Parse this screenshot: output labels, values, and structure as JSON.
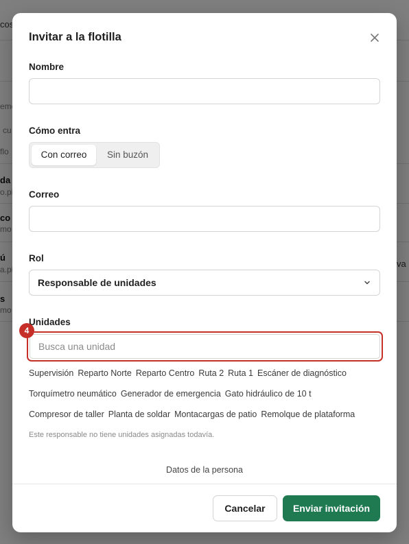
{
  "background": {
    "fragments": [
      "cos",
      "emo",
      "cu",
      "flo",
      "da",
      "o.pi",
      "co",
      "mo",
      "ú",
      "a.pi",
      "s",
      "mo",
      "va"
    ]
  },
  "modal": {
    "title": "Invitar a la flotilla",
    "close_icon": "close-icon",
    "name": {
      "label": "Nombre",
      "value": "",
      "placeholder": ""
    },
    "entry": {
      "label": "Cómo entra",
      "options": [
        "Con correo",
        "Sin buzón"
      ],
      "selected": "Con correo"
    },
    "email": {
      "label": "Correo",
      "value": "",
      "placeholder": ""
    },
    "role": {
      "label": "Rol",
      "value": "Responsable de unidades",
      "icon": "chevron-down-icon"
    },
    "units": {
      "label": "Unidades",
      "step_badge": "4",
      "search_placeholder": "Busca una unidad",
      "chips": [
        "Supervisión",
        "Reparto Norte",
        "Reparto Centro",
        "Ruta 2",
        "Ruta 1",
        "Escáner de diagnóstico",
        "Torquímetro neumático",
        "Generador de emergencia",
        "Gato hidráulico de 10 t",
        "Compresor de taller",
        "Planta de soldar",
        "Montacargas de patio",
        "Remolque de plataforma"
      ],
      "empty_note": "Este responsable no tiene unidades asignadas todavía."
    },
    "section_link": "Datos de la persona",
    "footer": {
      "cancel_label": "Cancelar",
      "submit_label": "Enviar invitación"
    }
  },
  "colors": {
    "accent": "#1f7a52",
    "highlight": "#c62f28"
  }
}
